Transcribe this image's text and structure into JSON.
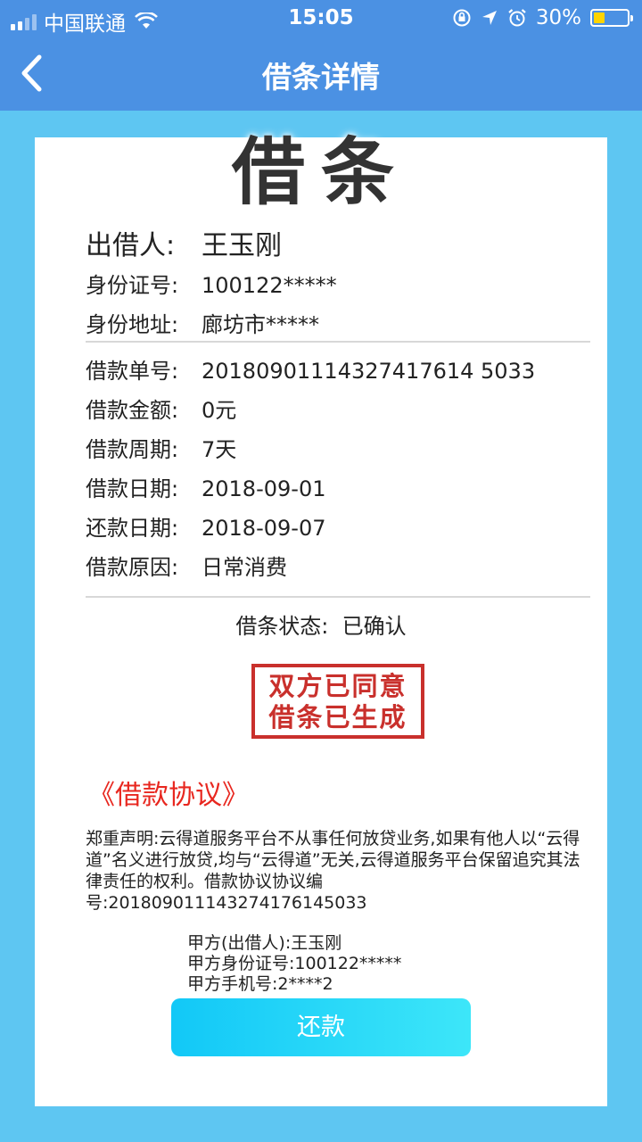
{
  "status_bar": {
    "carrier": "中国联通",
    "time": "15:05",
    "battery": "30%"
  },
  "header": {
    "title": "借条详情"
  },
  "note": {
    "big_title": "借条",
    "lender": {
      "label": "出借人:",
      "value": "王玉刚"
    },
    "id_number": {
      "label": "身份证号:",
      "value": "100122*****"
    },
    "address": {
      "label": "身份地址:",
      "value": "廊坊市*****"
    },
    "loan_no": {
      "label": "借款单号:",
      "value": "20180901114327417614 5033"
    },
    "amount": {
      "label": "借款金额:",
      "value": "0元"
    },
    "period": {
      "label": "借款周期:",
      "value": "7天"
    },
    "loan_date": {
      "label": "借款日期:",
      "value": "2018-09-01"
    },
    "repay_date": {
      "label": "还款日期:",
      "value": "2018-09-07"
    },
    "reason": {
      "label": "借款原因:",
      "value": "日常消费"
    },
    "status": {
      "label": "借条状态:",
      "value": "已确认"
    }
  },
  "stamp": {
    "line1": "双方已同意",
    "line2": "借条已生成"
  },
  "agreement": {
    "link": "《借款协议》",
    "statement": "郑重声明:云得道服务平台不从事任何放贷业务,如果有他人以“云得道”名义进行放贷,均与“云得道”无关,云得道服务平台保留追究其法律责任的权利。借款协议协议编号:201809011143274176145033",
    "party_a": "甲方(出借人):王玉刚",
    "party_a_id": "甲方身份证号:100122*****",
    "party_a_phone": "甲方手机号:2****2"
  },
  "actions": {
    "repay": "还款"
  },
  "colors": {
    "header_bg": "#4b91e3",
    "page_bg": "#5ec6f2",
    "stamp_red": "#c9302c",
    "link_red": "#e8271f",
    "button_start": "#12c8f7",
    "button_end": "#3de6f9"
  }
}
